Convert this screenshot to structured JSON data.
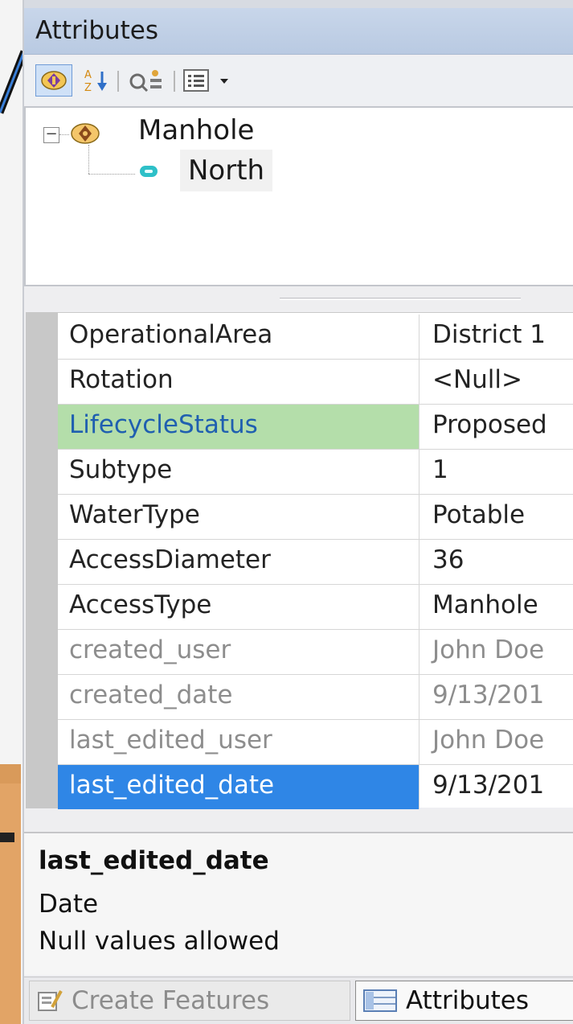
{
  "window": {
    "title": "Attributes"
  },
  "toolbar": {
    "buttons": [
      {
        "name": "list-by-layer",
        "icon": "layer-diamond-icon",
        "active": true
      },
      {
        "name": "sort",
        "icon": "sort-az-icon"
      },
      {
        "name": "filter",
        "icon": "filter-fields-icon"
      },
      {
        "name": "options",
        "icon": "list-options-icon",
        "has_dropdown": true
      }
    ]
  },
  "tree": {
    "root": {
      "label": "Manhole",
      "icon": "feature-layer-icon",
      "expanded": true,
      "expander_symbol": "−"
    },
    "child": {
      "label": "North",
      "icon": "feature-record-icon"
    }
  },
  "grid": {
    "rows": [
      {
        "name": "OperationalArea",
        "value": "District 1",
        "state": "normal"
      },
      {
        "name": "Rotation",
        "value": "<Null>",
        "state": "normal"
      },
      {
        "name": "LifecycleStatus",
        "value": "Proposed",
        "state": "highlight"
      },
      {
        "name": "Subtype",
        "value": "1",
        "state": "normal"
      },
      {
        "name": "WaterType",
        "value": "Potable",
        "state": "normal"
      },
      {
        "name": "AccessDiameter",
        "value": "36",
        "state": "normal"
      },
      {
        "name": "AccessType",
        "value": "Manhole",
        "state": "normal"
      },
      {
        "name": "created_user",
        "value": "John Doe",
        "state": "readonly"
      },
      {
        "name": "created_date",
        "value": "9/13/201",
        "state": "readonly"
      },
      {
        "name": "last_edited_user",
        "value": "John Doe",
        "state": "readonly"
      },
      {
        "name": "last_edited_date",
        "value": "9/13/201",
        "state": "selected"
      }
    ],
    "colors": {
      "highlight": "#b4deaa",
      "selected": "#2f86e6",
      "readonly_text": "#8d8d8d"
    }
  },
  "description": {
    "field": "last_edited_date",
    "type": "Date",
    "nullable": "Null values allowed"
  },
  "tabs": [
    {
      "label": "Create Features",
      "icon": "create-features-icon",
      "active": false
    },
    {
      "label": "Attributes",
      "icon": "attributes-table-icon",
      "active": true
    }
  ]
}
